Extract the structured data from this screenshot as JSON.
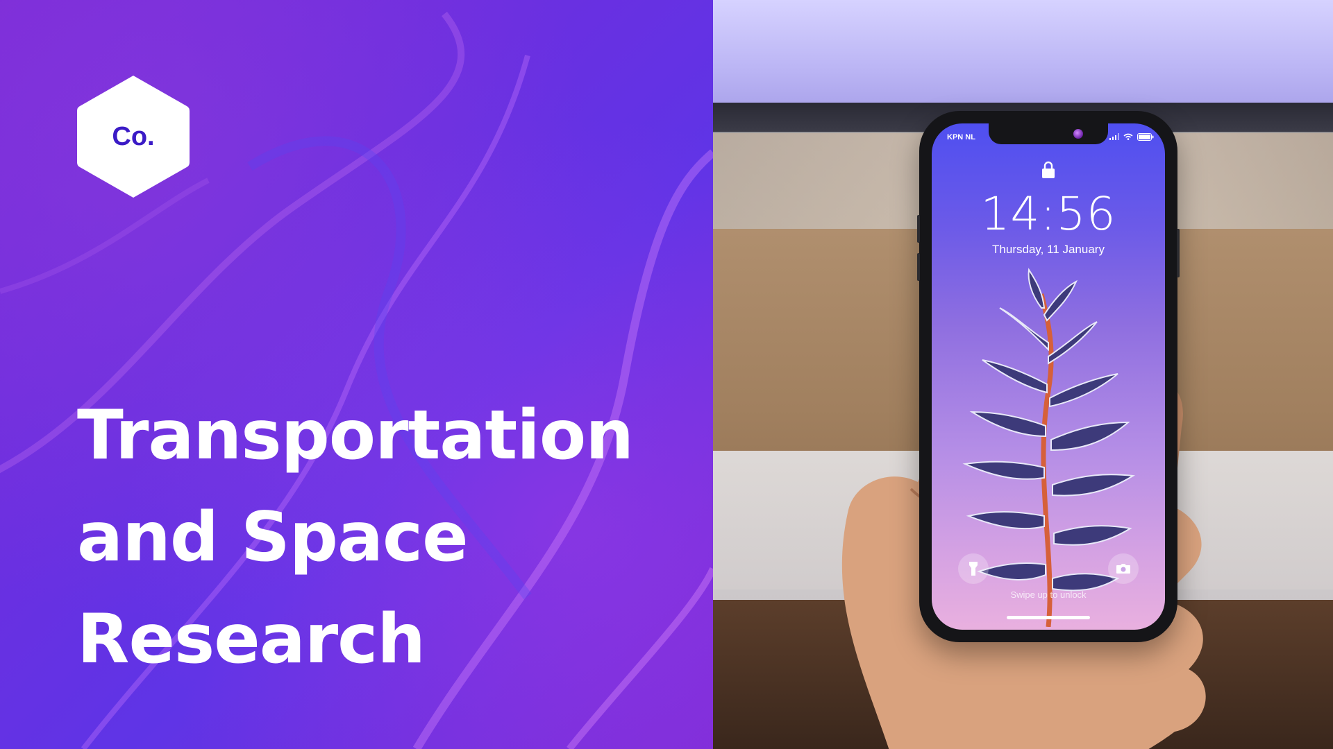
{
  "logo": {
    "text": "Co.",
    "icon": "hexagon-logo-icon",
    "shape_color": "#ffffff",
    "text_color": "#3b1bc6"
  },
  "title": {
    "lines": [
      "Transportation",
      "and Space",
      "Research"
    ],
    "color": "#ffffff"
  },
  "background": {
    "left_panel_color": "#6a2bd9"
  },
  "phone": {
    "carrier": "KPN NL",
    "time": "14:56",
    "date": "Thursday, 11 January",
    "swipe_hint": "Swipe up to unlock",
    "icons": {
      "lock": "lock-icon",
      "flashlight": "flashlight-icon",
      "camera": "camera-icon",
      "signal": "signal-icon",
      "wifi": "wifi-icon",
      "battery": "battery-icon"
    }
  }
}
